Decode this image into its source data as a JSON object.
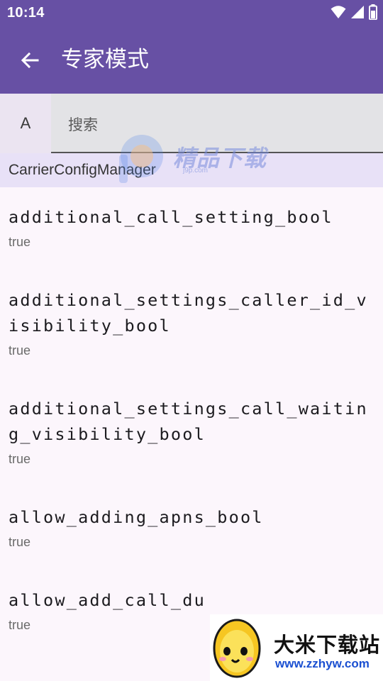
{
  "status_bar": {
    "time": "10:14",
    "icons": [
      "wifi-icon",
      "cell-signal-icon",
      "battery-icon"
    ]
  },
  "app_bar": {
    "title": "专家模式",
    "back_icon": "arrow-back-icon",
    "background": "#6750a4"
  },
  "search": {
    "alpha_tab": "A",
    "placeholder": "搜索"
  },
  "section": {
    "label": "CarrierConfigManager"
  },
  "items": [
    {
      "key": "additional_call_setting_bool",
      "value": "true"
    },
    {
      "key": "additional_settings_caller_id_visibility_bool",
      "value": "true"
    },
    {
      "key": "additional_settings_call_waiting_visibility_bool",
      "value": "true"
    },
    {
      "key": "allow_adding_apns_bool",
      "value": "true"
    },
    {
      "key": "allow_add_call_du",
      "value": "true"
    }
  ],
  "watermarks": {
    "top_text": "精品下载",
    "top_url": "j9p.com",
    "bottom_text": "大米下载站",
    "bottom_url": "www.zzhyw.com"
  }
}
